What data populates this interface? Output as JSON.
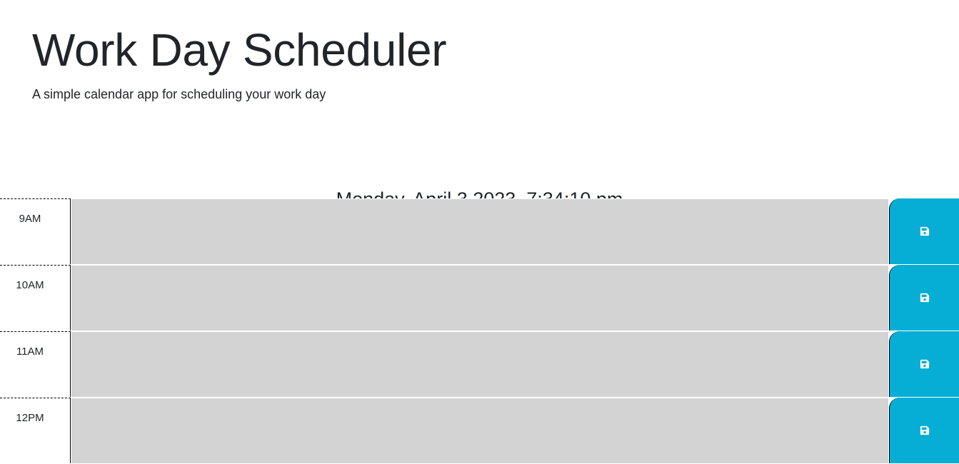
{
  "header": {
    "title": "Work Day Scheduler",
    "subtitle": "A simple calendar app for scheduling your work day",
    "current_day": "Monday, April 3 2023, 7:34:10 pm"
  },
  "time_blocks": [
    {
      "hour": "9AM",
      "description": "",
      "save_icon": "floppy-disk-icon"
    },
    {
      "hour": "10AM",
      "description": "",
      "save_icon": "floppy-disk-icon"
    },
    {
      "hour": "11AM",
      "description": "",
      "save_icon": "floppy-disk-icon"
    },
    {
      "hour": "12PM",
      "description": "",
      "save_icon": "floppy-disk-icon"
    }
  ],
  "colors": {
    "past_block": "#d3d3d3",
    "save_button": "#06aed5",
    "save_icon": "#ffffff",
    "text": "#212529"
  }
}
